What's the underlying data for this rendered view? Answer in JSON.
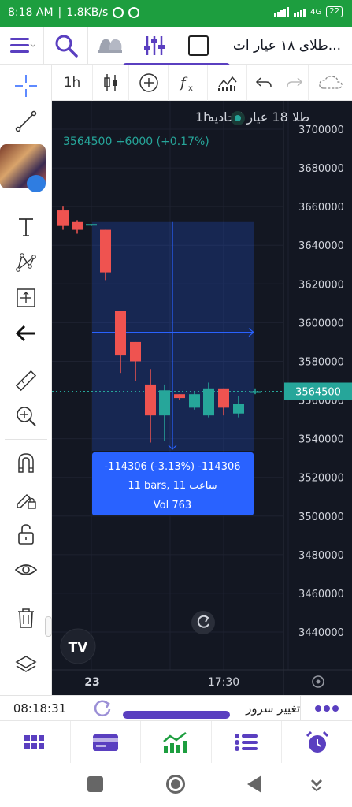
{
  "status_bar": {
    "time": "8:18 AM",
    "speed": "1.8KB/s",
    "network": "4G",
    "battery": "22"
  },
  "header": {
    "symbol_title": "طلای ۱۸ عیار ات..."
  },
  "chart_toolbar": {
    "interval": "1h"
  },
  "chart": {
    "legend_interval": "1h",
    "legend_title": "طلا 18 عیار اتحادیه",
    "legend_values": "3564500  +6000 (+0.17%)",
    "price_axis": [
      "3700000",
      "3680000",
      "3660000",
      "3640000",
      "3620000",
      "3600000",
      "3580000",
      "3560000",
      "3540000",
      "3520000",
      "3500000",
      "3480000",
      "3460000",
      "3440000"
    ],
    "current_price_label": "3564500",
    "date_label": "23",
    "time_label": "17:30",
    "measure_tooltip": {
      "line1": "-114306 (-3.13%) -114306",
      "line2": "11 bars, 11 ساعت",
      "line3": "Vol 763"
    },
    "colors": {
      "up": "#26a69a",
      "down": "#ef5350",
      "background": "#131722",
      "selection": "#2962ff"
    }
  },
  "chart_data": {
    "type": "candlestick",
    "ylim": [
      3430000,
      3710000
    ],
    "candles": [
      {
        "o": 3658000,
        "h": 3660000,
        "l": 3648000,
        "c": 3650000
      },
      {
        "o": 3652000,
        "h": 3653000,
        "l": 3646000,
        "c": 3648000
      },
      {
        "o": 3651000,
        "h": 3651000,
        "l": 3650000,
        "c": 3651000
      },
      {
        "o": 3648000,
        "h": 3648000,
        "l": 3622000,
        "c": 3626000
      },
      {
        "o": 3606000,
        "h": 3606000,
        "l": 3574000,
        "c": 3583000
      },
      {
        "o": 3590000,
        "h": 3590000,
        "l": 3570000,
        "c": 3580000
      },
      {
        "o": 3568000,
        "h": 3576000,
        "l": 3538000,
        "c": 3552000
      },
      {
        "o": 3552000,
        "h": 3568000,
        "l": 3539000,
        "c": 3565000
      },
      {
        "o": 3563000,
        "h": 3563000,
        "l": 3560000,
        "c": 3561000
      },
      {
        "o": 3556000,
        "h": 3564000,
        "l": 3555000,
        "c": 3563000
      },
      {
        "o": 3552000,
        "h": 3569000,
        "l": 3551000,
        "c": 3566000
      },
      {
        "o": 3566000,
        "h": 3566000,
        "l": 3552000,
        "c": 3556000
      },
      {
        "o": 3553000,
        "h": 3562000,
        "l": 3551000,
        "c": 3558000
      },
      {
        "o": 3564000,
        "h": 3566000,
        "l": 3563000,
        "c": 3564500
      }
    ]
  },
  "info_bar": {
    "clock": "08:18:31",
    "server_label": "تغییر سرور"
  }
}
